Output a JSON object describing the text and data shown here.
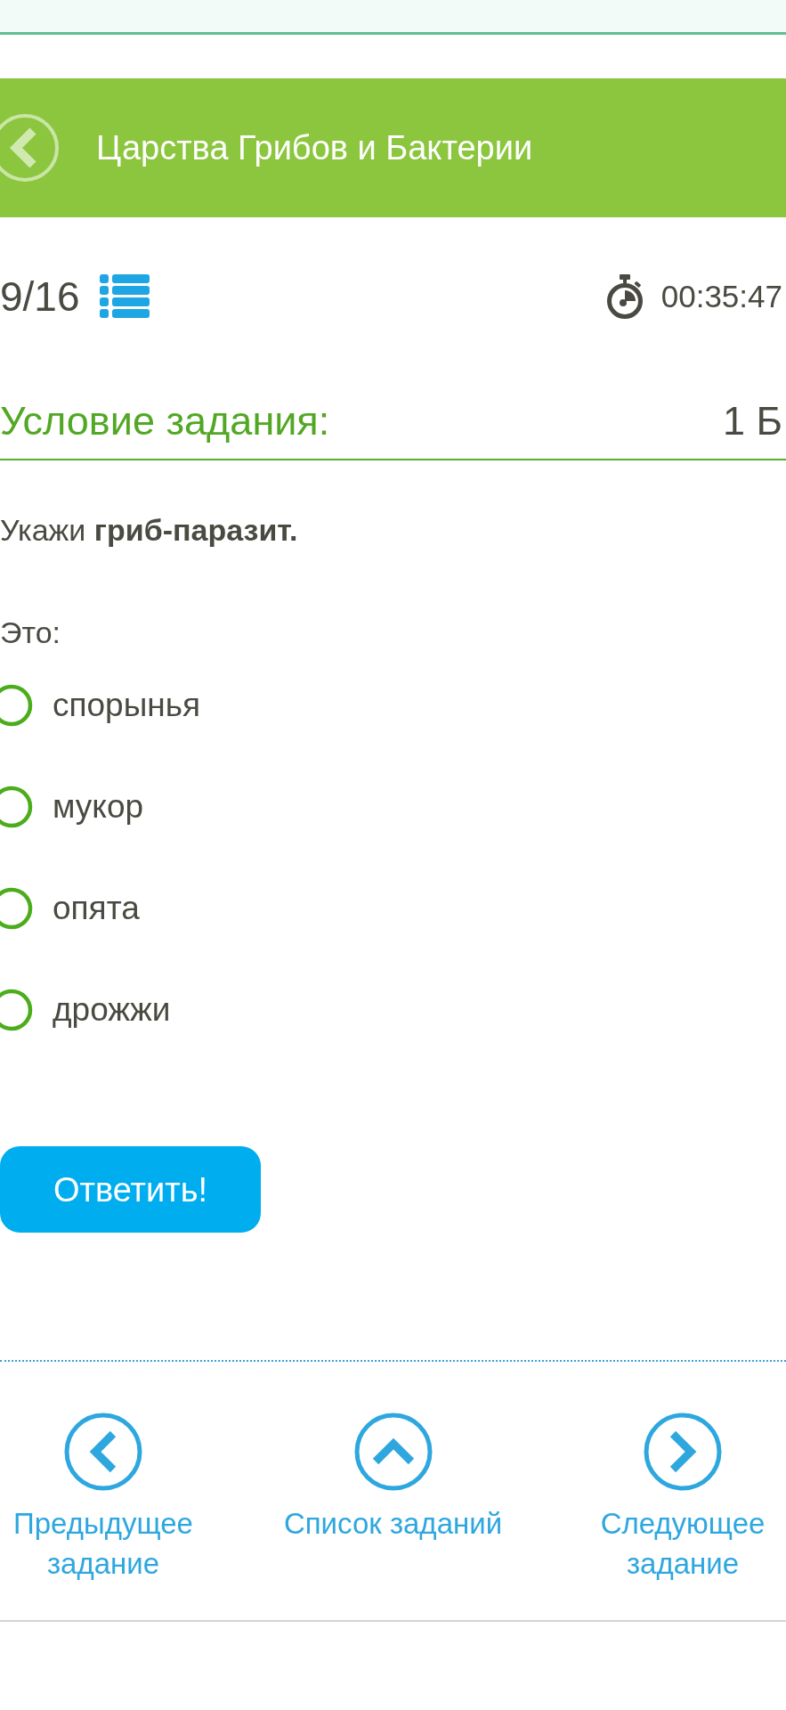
{
  "header": {
    "title": "Царства Грибов и Бактерии"
  },
  "progress": {
    "counter": "9/16"
  },
  "timer": {
    "time": "00:35:47"
  },
  "task": {
    "heading": "Условие задания:",
    "points": "1 Б",
    "question": "Укажи **гриб-паразит.**",
    "prompt": "Это:"
  },
  "options": [
    {
      "label": "спорынья",
      "selected": false
    },
    {
      "label": "мукор",
      "selected": false
    },
    {
      "label": "опята",
      "selected": false
    },
    {
      "label": "дрожжи",
      "selected": false
    }
  ],
  "submit": {
    "label": "Ответить!"
  },
  "nav": [
    {
      "kind": "previous",
      "label": "Предыдущее задание"
    },
    {
      "kind": "list",
      "label": "Список заданий"
    },
    {
      "kind": "next",
      "label": "Следующее задание"
    }
  ]
}
